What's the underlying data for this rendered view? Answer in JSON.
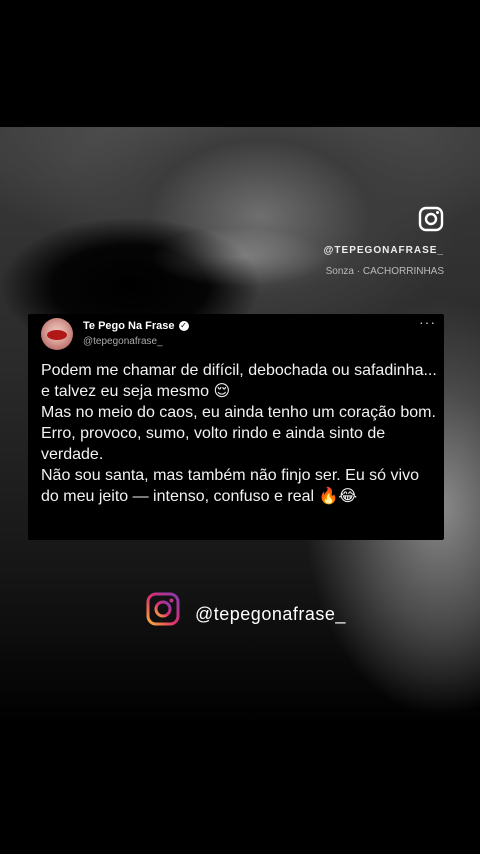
{
  "overlay": {
    "ig_handle": "@TEPEGONAFRASE_",
    "music_label": "Sonza · CACHORRINHAS",
    "music_icon": "sound-note-icon"
  },
  "post": {
    "display_name": "Te Pego Na Frase",
    "username": "@tepegonafrase_",
    "verified_icon": "verified-check-icon",
    "more_label": "···",
    "lines": [
      "Podem me chamar de difícil, debochada ou safadinha... e talvez eu seja mesmo 😌",
      "Mas no meio do caos, eu ainda tenho um coração bom.",
      "Erro, provoco, sumo, volto rindo e ainda sinto de verdade.",
      "Não sou santa, mas também não finjo ser. Eu só vivo do meu jeito — intenso, confuso e real 🔥😂"
    ]
  },
  "footer": {
    "handle": "@tepegonafrase_",
    "icon": "instagram-icon"
  },
  "colors": {
    "background": "#000000",
    "text": "#ffffff",
    "muted": "#aaaaaa"
  }
}
